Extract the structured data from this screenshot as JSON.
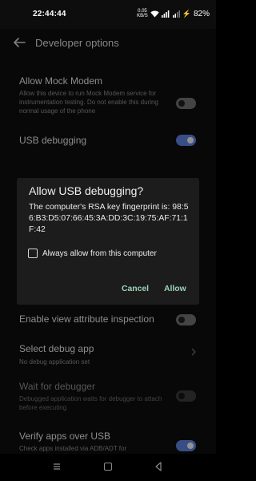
{
  "status_bar": {
    "time": "22:44:44",
    "net_speed_value": "0.05",
    "net_speed_unit": "KB/S",
    "battery": "82%"
  },
  "header": {
    "title": "Developer options",
    "back_icon": "arrow-left-icon"
  },
  "settings": {
    "mock_modem_title": "Allow Mock Modem",
    "mock_modem_desc": "Allow this device to run Mock Modem service for instrumentation testing. Do not enable this during normal usage of the phone",
    "mock_modem_enabled": false,
    "usb_debugging_title": "USB debugging",
    "usb_debugging_enabled": true,
    "view_attr_title": "Enable view attribute inspection",
    "view_attr_enabled": false,
    "debug_app_title": "Select debug app",
    "debug_app_desc": "No debug application set",
    "wait_debugger_title": "Wait for debugger",
    "wait_debugger_desc": "Debugged application waits for debugger to attach before executing",
    "wait_debugger_enabled": false,
    "verify_apps_title": "Verify apps over USB",
    "verify_apps_desc": "Check apps installed via ADB/ADT for",
    "verify_apps_enabled": true
  },
  "dialog": {
    "title": "Allow USB debugging?",
    "message": "The computer's RSA key fingerprint is: 98:56:B3:D5:07:66:45:3A:DD:3C:19:75:AF:71:1F:42",
    "checkbox_label": "Always allow from this computer",
    "checkbox_checked": false,
    "cancel_label": "Cancel",
    "allow_label": "Allow"
  },
  "nav": {
    "menu_icon": "recent-apps-icon",
    "home_icon": "home-icon",
    "back_icon": "back-triangle-icon"
  },
  "colors": {
    "accent_toggle": "#5b7fd6",
    "dialog_button": "#9bd3b8",
    "background": "#0d0d0d",
    "dialog_bg": "#1c1c1c"
  }
}
